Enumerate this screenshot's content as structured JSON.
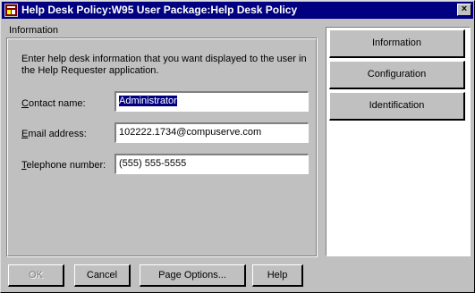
{
  "window": {
    "title": "Help Desk Policy:W95 User Package:Help Desk Policy",
    "close_glyph": "×"
  },
  "section": {
    "label": "Information"
  },
  "description": "Enter help desk information that you want displayed to the user in the Help Requester application.",
  "fields": {
    "contact": {
      "label_prefix": "C",
      "label_rest": "ontact name:",
      "value": "Administrator"
    },
    "email": {
      "label_prefix": "E",
      "label_rest": "mail address:",
      "value": "102222.1734@compuserve.com"
    },
    "phone": {
      "label_prefix": "T",
      "label_rest": "elephone number:",
      "value": "(555) 555-5555"
    }
  },
  "nav": {
    "information": "Information",
    "configuration": "Configuration",
    "identification": "Identification"
  },
  "buttons": {
    "ok": "OK",
    "cancel": "Cancel",
    "page_options": "Page Options...",
    "help": "Help"
  }
}
